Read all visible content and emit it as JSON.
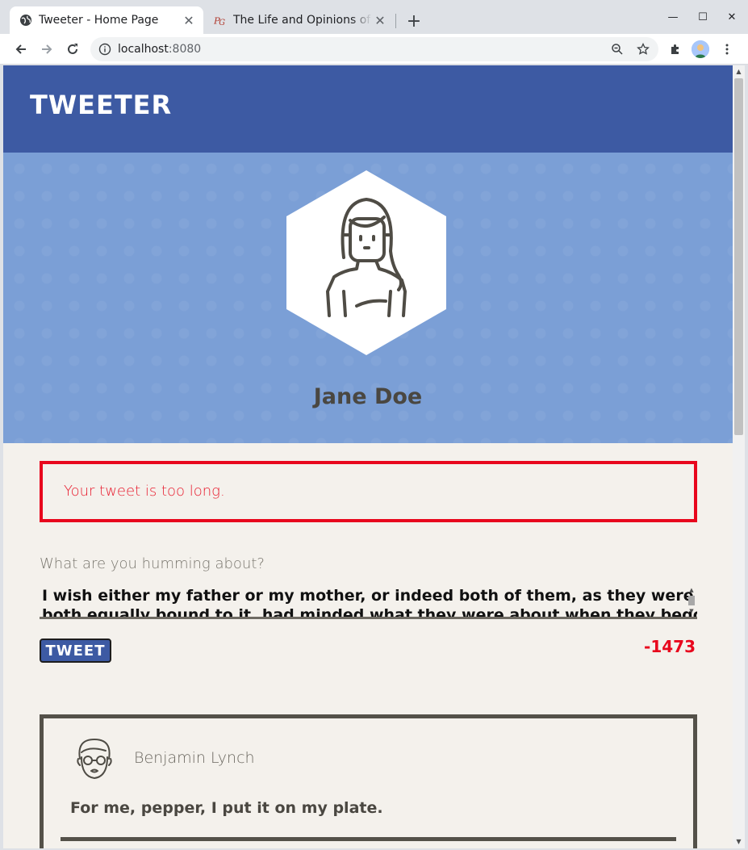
{
  "browser": {
    "tabs": [
      {
        "title": "Tweeter - Home Page",
        "favicon": "globe-icon",
        "active": true
      },
      {
        "title": "The Life and Opinions of Tristram Shandy",
        "favicon": "project-gutenberg-icon",
        "active": false
      }
    ],
    "new_tab_label": "+",
    "window_controls": {
      "minimize": "—",
      "maximize": "☐",
      "close": "✕"
    },
    "address": {
      "host": "localhost",
      "port": ":8080"
    }
  },
  "site": {
    "logo": "Tweeter"
  },
  "profile": {
    "name": "Jane Doe"
  },
  "error": {
    "message": "Your tweet is too long."
  },
  "compose": {
    "label": "What are you humming about?",
    "text_line1": "I wish either my father or my mother, or indeed both of them, as they were in duty",
    "text_line2": "both equally bound to it, had minded what they were about when they begot me; had",
    "button_label": "Tweet",
    "counter": "-1473"
  },
  "tweets": [
    {
      "author": "Benjamin Lynch",
      "body": "For me, pepper, I put it on my plate."
    }
  ],
  "colors": {
    "header": "#3d5aa3",
    "profile_bg": "#7b9fd6",
    "page_bg": "#f4f1ec",
    "error": "#e8071d"
  }
}
